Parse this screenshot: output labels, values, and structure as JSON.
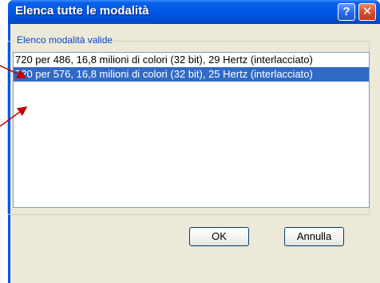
{
  "window": {
    "title": "Elenca tutte le modalità",
    "help_glyph": "?",
    "close_glyph": "✕"
  },
  "group": {
    "label": "Elenco modalità valide"
  },
  "list": {
    "items": [
      {
        "text": "720 per 486, 16,8 milioni di colori (32 bit), 29 Hertz (interlacciato)",
        "selected": false
      },
      {
        "text": "720 per 576, 16,8 milioni di colori (32 bit), 25 Hertz (interlacciato)",
        "selected": true
      }
    ]
  },
  "buttons": {
    "ok_label": "OK",
    "cancel_label": "Annulla"
  },
  "colors": {
    "titlebar": "#0058e6",
    "selection": "#316ac5",
    "group_label": "#0046d5",
    "annotation_arrow": "#c00000"
  }
}
